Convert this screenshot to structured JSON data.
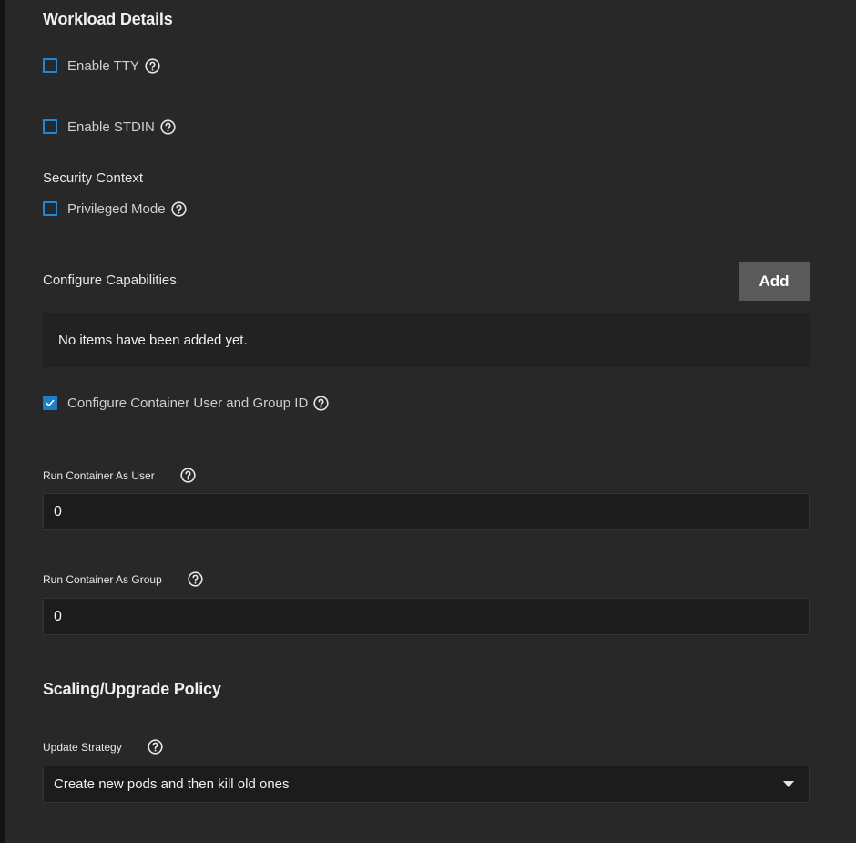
{
  "workload": {
    "title": "Workload Details",
    "enable_tty": {
      "label": "Enable TTY",
      "checked": false
    },
    "enable_stdin": {
      "label": "Enable STDIN",
      "checked": false
    },
    "security_context_label": "Security Context",
    "privileged_mode": {
      "label": "Privileged Mode",
      "checked": false
    },
    "configure_capabilities_label": "Configure Capabilities",
    "add_label": "Add",
    "empty_message": "No items have been added yet.",
    "configure_user_group": {
      "label": "Configure Container User and Group ID",
      "checked": true
    },
    "run_as_user": {
      "label": "Run Container As User",
      "value": "0"
    },
    "run_as_group": {
      "label": "Run Container As Group",
      "value": "0"
    }
  },
  "scaling": {
    "title": "Scaling/Upgrade Policy",
    "update_strategy": {
      "label": "Update Strategy",
      "selected": "Create new pods and then kill old ones"
    }
  },
  "colors": {
    "background": "#282828",
    "checkbox_accent": "#1b7fc4",
    "button_bg": "#5a5a5a",
    "field_bg": "#1c1c1c"
  },
  "icons": [
    "help-circle-icon",
    "check-icon",
    "caret-down-icon"
  ]
}
